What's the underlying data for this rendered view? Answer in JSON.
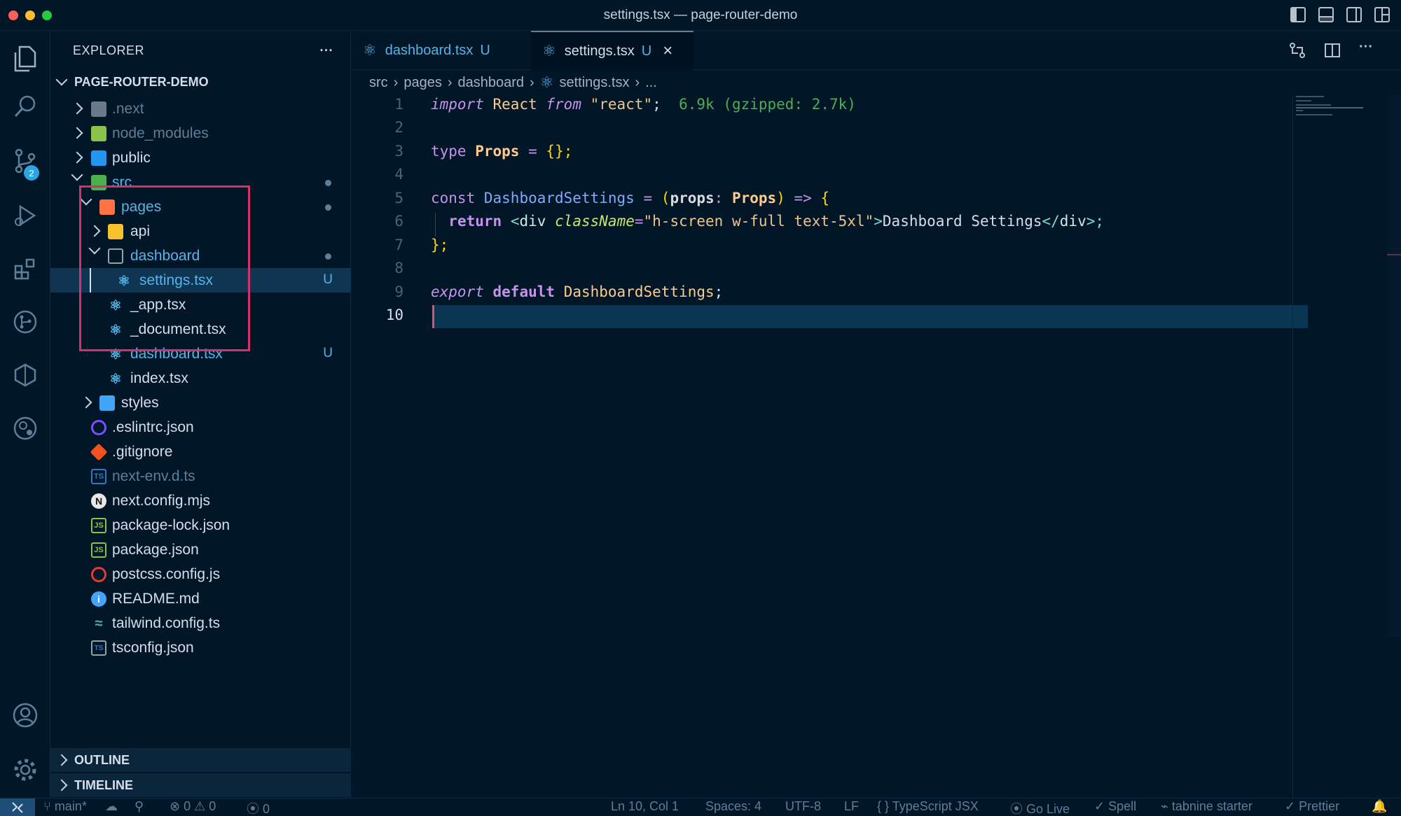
{
  "window": {
    "title": "settings.tsx — page-router-demo"
  },
  "explorer": {
    "title": "EXPLORER",
    "more": "···",
    "root": "PAGE-ROUTER-DEMO"
  },
  "tree": {
    "next": ".next",
    "node_modules": "node_modules",
    "public": "public",
    "src": "src",
    "pages": "pages",
    "api": "api",
    "dashboard": "dashboard",
    "settings": "settings.tsx",
    "app": "_app.tsx",
    "document": "_document.tsx",
    "dashboard_tsx": "dashboard.tsx",
    "index": "index.tsx",
    "styles": "styles",
    "eslintrc": ".eslintrc.json",
    "gitignore": ".gitignore",
    "next_env": "next-env.d.ts",
    "next_config": "next.config.mjs",
    "package_lock": "package-lock.json",
    "package": "package.json",
    "postcss": "postcss.config.js",
    "readme": "README.md",
    "tailwind": "tailwind.config.ts",
    "tsconfig": "tsconfig.json",
    "untracked": "U"
  },
  "sections": {
    "outline": "OUTLINE",
    "timeline": "TIMELINE"
  },
  "tabs": [
    {
      "label": "dashboard.tsx",
      "status": "U"
    },
    {
      "label": "settings.tsx",
      "status": "U"
    }
  ],
  "breadcrumb": {
    "a": "src",
    "b": "pages",
    "c": "dashboard",
    "d": "settings.tsx",
    "e": "..."
  },
  "activity": {
    "scm_badge": "2"
  },
  "editor": {
    "lines": [
      "1",
      "2",
      "3",
      "4",
      "5",
      "6",
      "7",
      "8",
      "9",
      "10"
    ],
    "l1": {
      "kw": "import",
      "id": "React",
      "from": "from",
      "str": "\"react\"",
      "semi": ";",
      "hint": "6.9k (gzipped: 2.7k)"
    },
    "l3": {
      "kw": "type",
      "name": "Props",
      "eq": "=",
      "rest": "{};"
    },
    "l5": {
      "kw": "const",
      "name": "DashboardSettings",
      "eq": "=",
      "p1": "(",
      "param": "props",
      "colon": ":",
      "type": "Props",
      "p2": ")",
      "arrow": "=>",
      "brace": "{"
    },
    "l6": {
      "kw": "return",
      "lt": "<",
      "tag": "div",
      "attr": "className",
      "eq": "=",
      "val": "\"h-screen w-full text-5xl\"",
      "gt": ">",
      "text": "Dashboard Settings",
      "close1": "</",
      "tag2": "div",
      "close2": ">;"
    },
    "l7": {
      "text": "};"
    },
    "l9": {
      "kw": "export",
      "kw2": "default",
      "name": "DashboardSettings",
      "semi": ";"
    }
  },
  "status": {
    "branch": "main*",
    "errors": "0",
    "warnings": "0",
    "ports": "0",
    "position": "Ln 10, Col 1",
    "spaces": "Spaces: 4",
    "encoding": "UTF-8",
    "eol": "LF",
    "language": "TypeScript JSX",
    "golive": "Go Live",
    "spell": "Spell",
    "tabnine": "tabnine starter",
    "prettier": "Prettier"
  },
  "colors": {
    "accent": "#55b5e9",
    "highlight_box": "#d62f6b",
    "bg": "#011627"
  }
}
